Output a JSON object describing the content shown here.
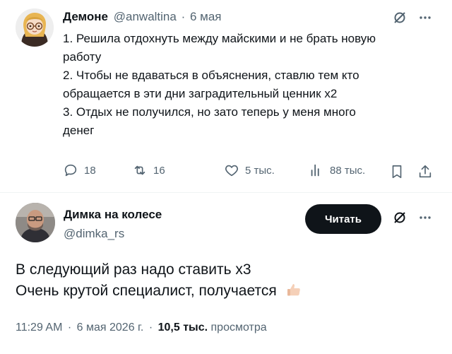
{
  "tweet1": {
    "display_name": "Демоне",
    "handle": "@anwaltina",
    "separator": "·",
    "date": "6 мая",
    "lines": [
      "1. Решила отдохнуть между майскими и не брать новую",
      "работу",
      "2. Чтобы не вдаваться в объяснения, ставлю тем кто",
      "обращается в эти дни заградительный ценник х2",
      "3. Отдых не получился, но зато теперь у меня много",
      "денег"
    ],
    "stats": {
      "replies": "18",
      "retweets": "16",
      "likes": "5 тыс.",
      "views": "88 тыс."
    }
  },
  "tweet2": {
    "display_name": "Димка на колесе",
    "handle": "@dimka_rs",
    "follow_label": "Читать",
    "lines": [
      "В следующий раз надо ставить х3",
      "Очень крутой специалист, получается"
    ],
    "meta": {
      "time": "11:29 AM",
      "sep1": "·",
      "date": "6 мая 2026 г.",
      "sep2": "·",
      "views_count": "10,5 тыс.",
      "views_label": "просмотра"
    }
  },
  "colors": {
    "text": "#0f1419",
    "muted": "#536471",
    "follow_bg": "#0f1419",
    "divider": "#eff3f4"
  },
  "icons": [
    "grok-icon",
    "more-icon",
    "reply-icon",
    "retweet-icon",
    "like-icon",
    "views-icon",
    "bookmark-icon",
    "share-icon",
    "thumbs-up-emoji"
  ]
}
